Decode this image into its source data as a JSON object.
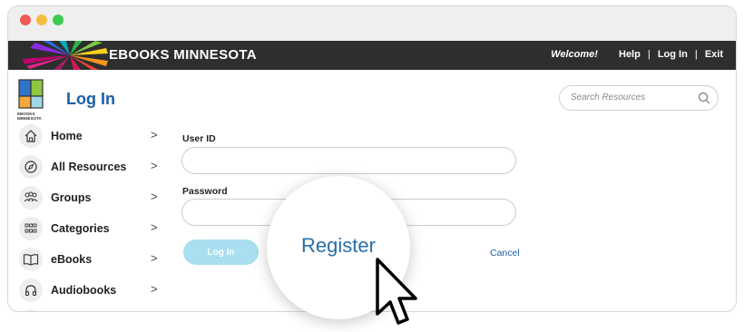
{
  "brand": {
    "name": "EBOOKS MINNESOTA"
  },
  "topnav": {
    "welcome": "Welcome!",
    "help": "Help",
    "login": "Log In",
    "exit": "Exit",
    "separator": "|"
  },
  "logo": {
    "line1": "EBOOKS",
    "line2": "MINNESOTA"
  },
  "page": {
    "title": "Log In"
  },
  "search": {
    "placeholder": "Search Resources",
    "icon": "search-icon"
  },
  "sidebar": {
    "items": [
      {
        "label": "Home",
        "icon": "home-icon"
      },
      {
        "label": "All Resources",
        "icon": "compass-icon"
      },
      {
        "label": "Groups",
        "icon": "groups-icon"
      },
      {
        "label": "Categories",
        "icon": "grid-icon"
      },
      {
        "label": "eBooks",
        "icon": "book-icon"
      },
      {
        "label": "Audiobooks",
        "icon": "headphones-icon"
      }
    ],
    "chevron": ">"
  },
  "form": {
    "user_id_label": "User ID",
    "user_id_value": "",
    "password_label": "Password",
    "password_value": "",
    "login_button": "Log In",
    "register": "Register",
    "cancel": "Cancel"
  },
  "colors": {
    "accent": "#1a5fa6",
    "topbar": "#2e2e2e",
    "login_button": "#a9dff0"
  }
}
